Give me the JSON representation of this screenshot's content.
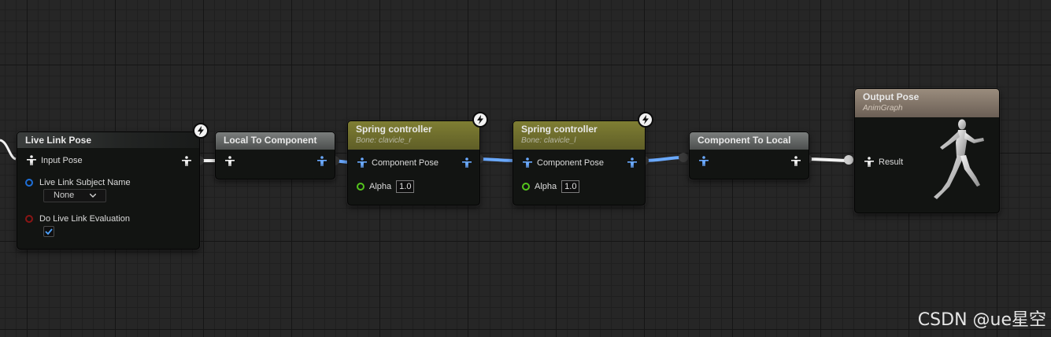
{
  "nodes": {
    "live_link_pose": {
      "title": "Live Link Pose",
      "input_pose": "Input Pose",
      "subject_name_label": "Live Link Subject Name",
      "subject_name_value": "None",
      "evaluation_label": "Do Live Link Evaluation",
      "evaluation_checked": true
    },
    "local_to_component": {
      "title": "Local To Component"
    },
    "spring_controller_r": {
      "title": "Spring controller",
      "subtitle": "Bone: clavicle_r",
      "component_pose": "Component Pose",
      "alpha_label": "Alpha",
      "alpha_value": "1.0"
    },
    "spring_controller_l": {
      "title": "Spring controller",
      "subtitle": "Bone: clavicle_l",
      "component_pose": "Component Pose",
      "alpha_label": "Alpha",
      "alpha_value": "1.0"
    },
    "component_to_local": {
      "title": "Component To Local"
    },
    "output_pose": {
      "title": "Output Pose",
      "subtitle": "AnimGraph",
      "result_label": "Result"
    }
  },
  "icons": {
    "pose_pin": "mannequin-icon",
    "fast_path": "lightning-bolt-icon",
    "dropdown": "chevron-down-icon",
    "checkbox": "checkmark-icon"
  },
  "colors": {
    "background": "#262626",
    "node_body": "#121412",
    "wire_local_pose": "#ffffff",
    "wire_component_pose": "#6aa9ff",
    "name_pin": "#1e6fd8",
    "bool_pin": "#8a1515",
    "float_pin": "#55c51d"
  },
  "watermark": "CSDN @ue星空"
}
